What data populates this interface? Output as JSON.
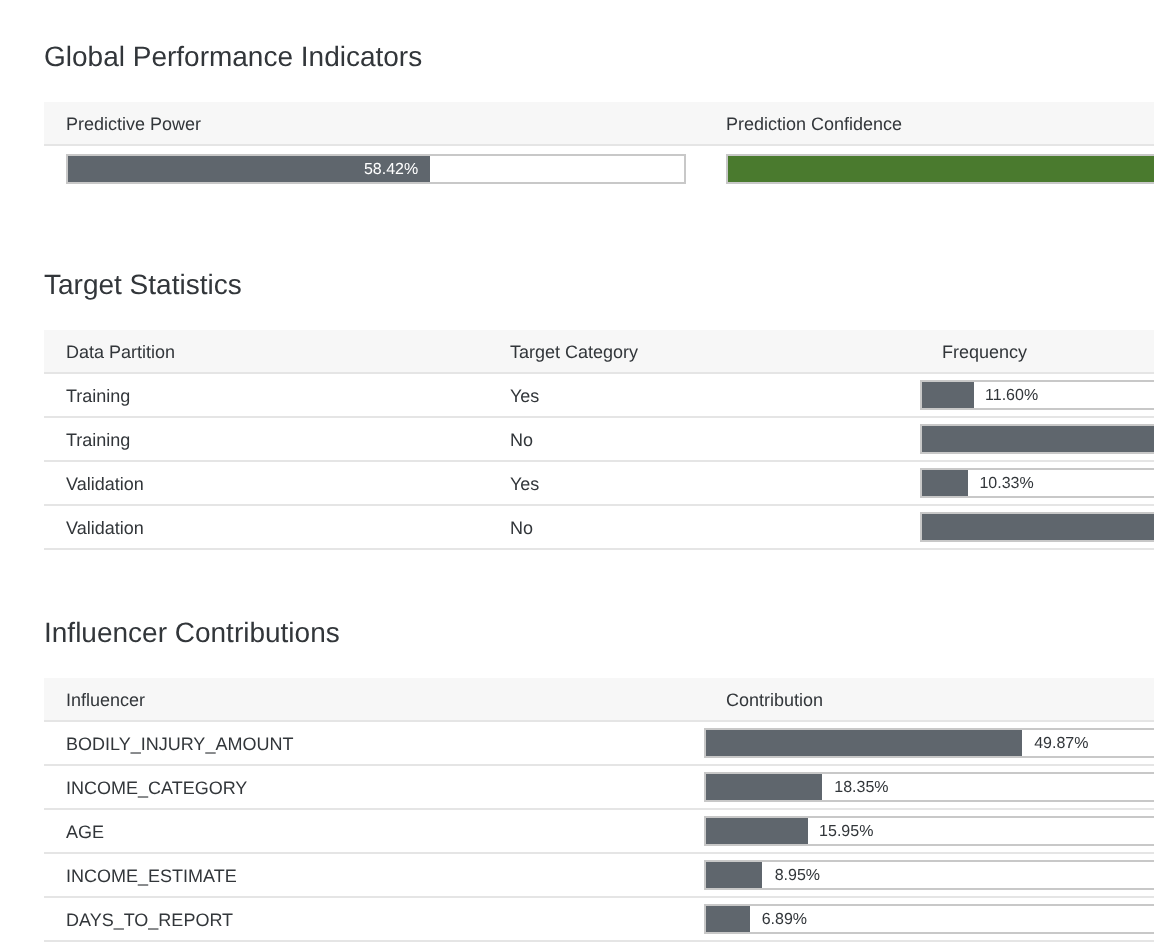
{
  "global_performance": {
    "title": "Global Performance Indicators",
    "columns": [
      "Predictive Power",
      "Prediction Confidence"
    ],
    "indicators": [
      {
        "kind": "inside",
        "level": 0.5842,
        "reading": "58.42%"
      },
      {
        "kind": "plain",
        "level": 0.97
      }
    ]
  },
  "target_statistics": {
    "title": "Target Statistics",
    "columns": [
      "Data Partition",
      "Target Category",
      "Frequency"
    ],
    "rows": [
      {
        "partition": "Training",
        "category": "Yes",
        "level": 0.116,
        "reading": "11.60%"
      },
      {
        "partition": "Training",
        "category": "No",
        "level": 0.884
      },
      {
        "partition": "Validation",
        "category": "Yes",
        "level": 0.1033,
        "reading": "10.33%"
      },
      {
        "partition": "Validation",
        "category": "No",
        "level": 0.8967
      }
    ]
  },
  "influencer_contributions": {
    "title": "Influencer Contributions",
    "columns": [
      "Influencer",
      "Contribution"
    ],
    "rows": [
      {
        "influencer": "BODILY_INJURY_AMOUNT",
        "level": 0.4987,
        "reading": "49.87%"
      },
      {
        "influencer": "INCOME_CATEGORY",
        "level": 0.1835,
        "reading": "18.35%"
      },
      {
        "influencer": "AGE",
        "level": 0.1595,
        "reading": "15.95%"
      },
      {
        "influencer": "INCOME_ESTIMATE",
        "level": 0.0895,
        "reading": "8.95%"
      },
      {
        "influencer": "DAYS_TO_REPORT",
        "level": 0.0689,
        "reading": "6.89%"
      }
    ]
  }
}
